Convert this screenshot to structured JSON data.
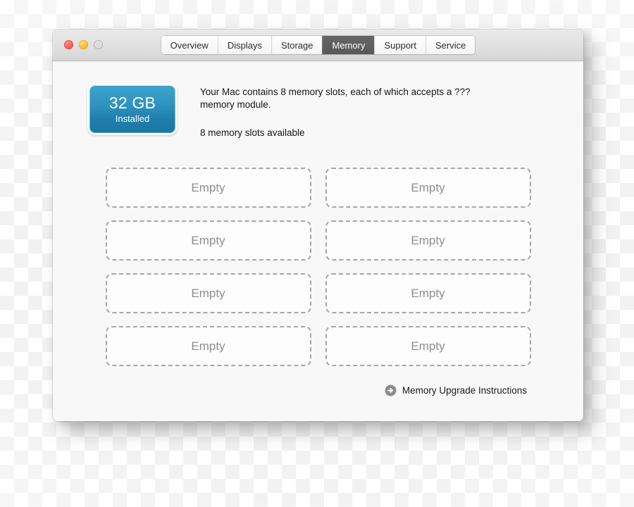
{
  "window": {
    "traffic_lights": [
      {
        "name": "close",
        "color": "#fa6057",
        "enabled": true
      },
      {
        "name": "minimize",
        "color": "#fdbd2e",
        "enabled": true
      },
      {
        "name": "zoom",
        "color": "#dcdcdc",
        "enabled": false
      }
    ]
  },
  "tabs": [
    {
      "label": "Overview",
      "selected": false
    },
    {
      "label": "Displays",
      "selected": false
    },
    {
      "label": "Storage",
      "selected": false
    },
    {
      "label": "Memory",
      "selected": true
    },
    {
      "label": "Support",
      "selected": false
    },
    {
      "label": "Service",
      "selected": false
    }
  ],
  "memory": {
    "capacity_value": "32 GB",
    "capacity_label": "Installed",
    "capacity_accent": "#2f93c0",
    "slots_description": "Your Mac contains 8 memory slots, each of which accepts a ??? memory module.",
    "slots_available": "8 memory slots available",
    "slots": [
      {
        "id": "slot-1",
        "status": "Empty"
      },
      {
        "id": "slot-2",
        "status": "Empty"
      },
      {
        "id": "slot-3",
        "status": "Empty"
      },
      {
        "id": "slot-4",
        "status": "Empty"
      },
      {
        "id": "slot-5",
        "status": "Empty"
      },
      {
        "id": "slot-6",
        "status": "Empty"
      },
      {
        "id": "slot-7",
        "status": "Empty"
      },
      {
        "id": "slot-8",
        "status": "Empty"
      }
    ]
  },
  "footer": {
    "upgrade_link_label": "Memory Upgrade Instructions",
    "upgrade_icon": "arrow-right-circle-icon",
    "upgrade_icon_color": "#8c8c8c"
  }
}
